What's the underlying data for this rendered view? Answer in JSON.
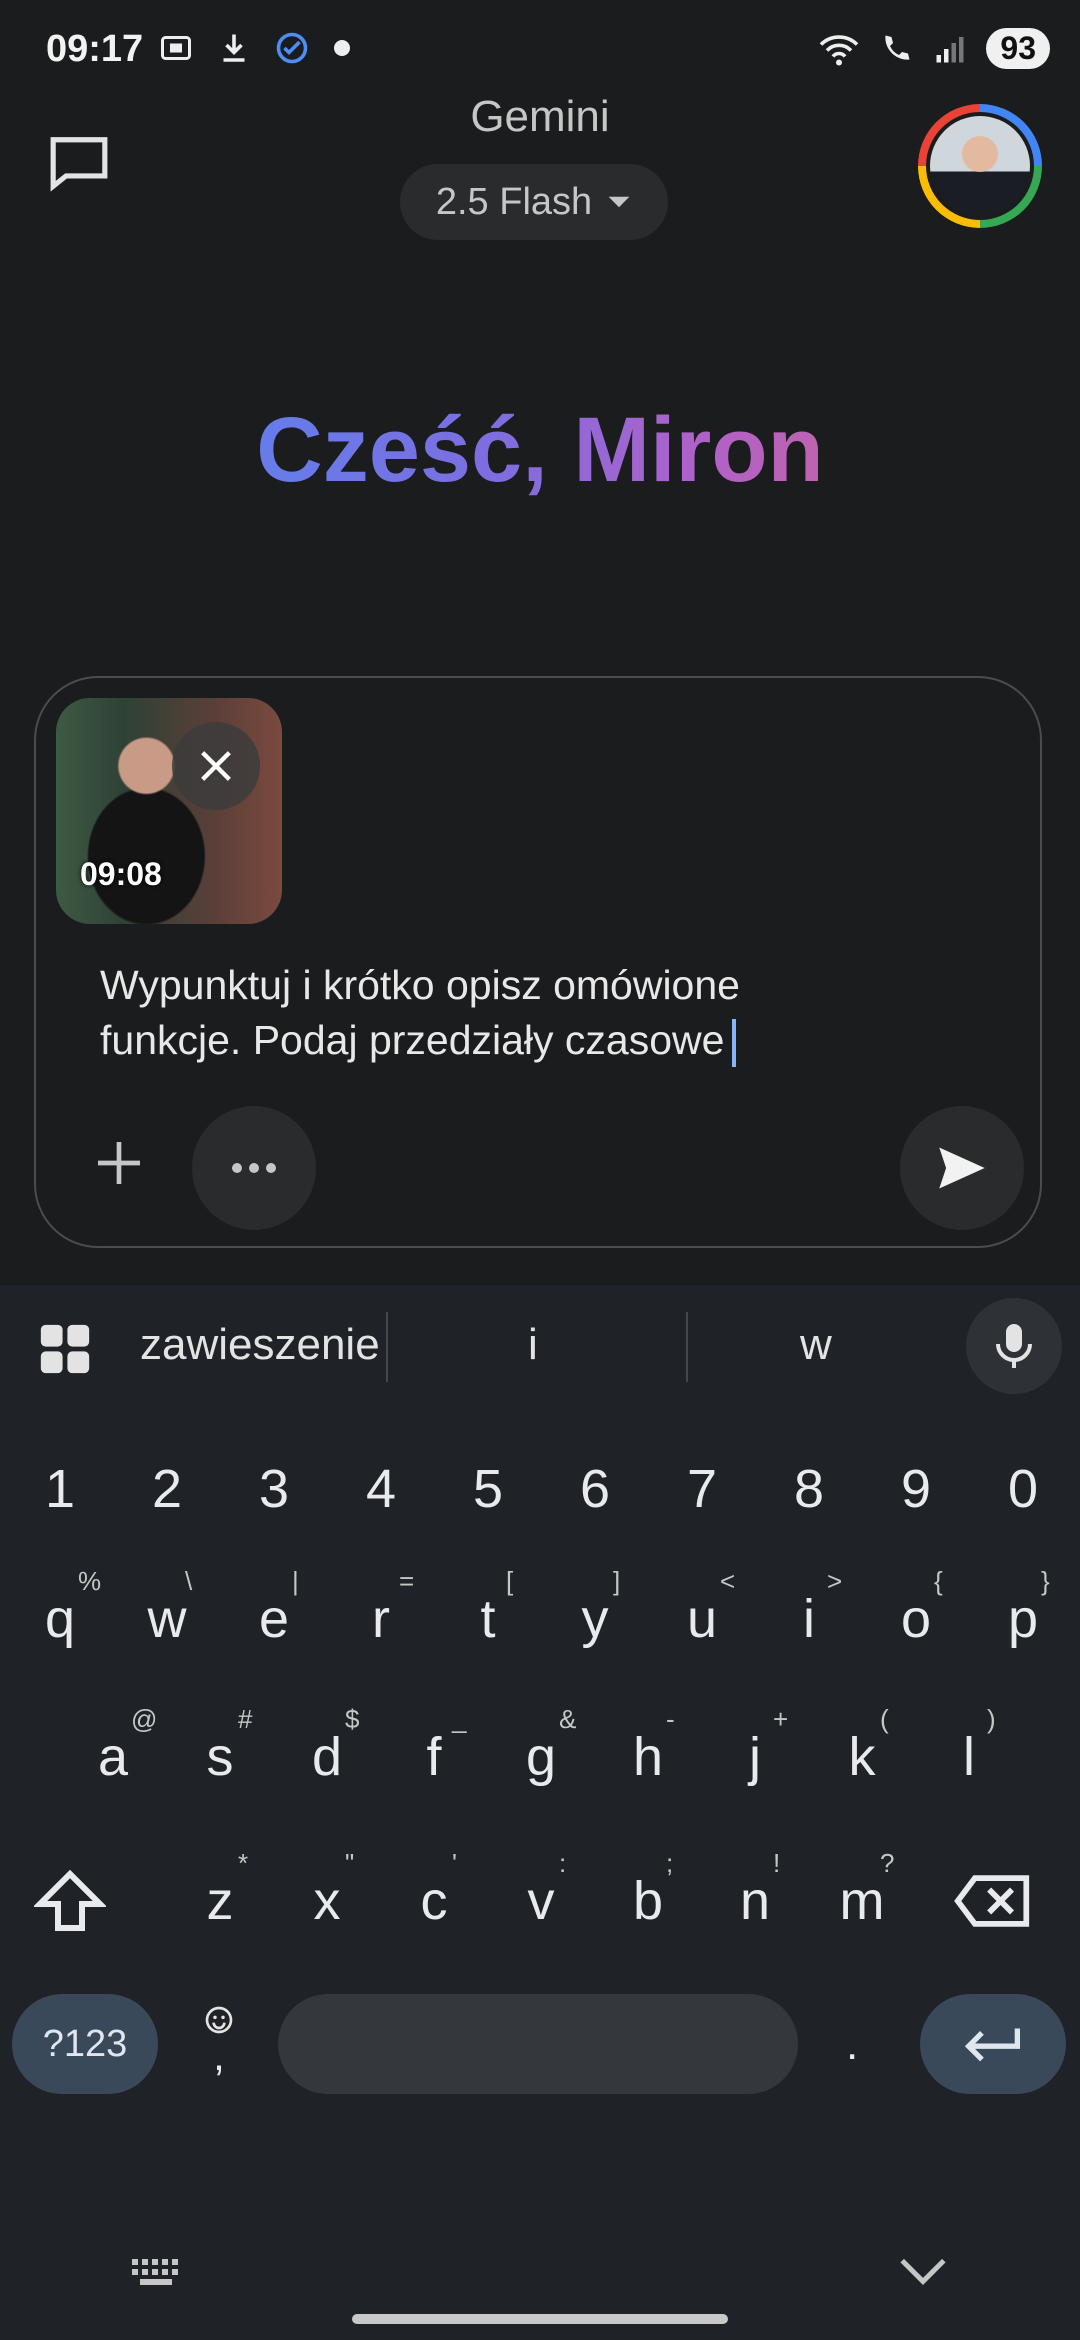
{
  "status_bar": {
    "time": "09:17",
    "battery": "93"
  },
  "header": {
    "app_title": "Gemini",
    "model": "2.5 Flash"
  },
  "greeting": "Cześć, Miron",
  "composer": {
    "attachment_time": "09:08",
    "prompt_line1": "Wypunktuj i krótko opisz omówione",
    "prompt_line2": "funkcje. Podaj przedziały czasowe"
  },
  "keyboard": {
    "suggestions": [
      "zawieszenie",
      "i",
      "w"
    ],
    "numbers": [
      "1",
      "2",
      "3",
      "4",
      "5",
      "6",
      "7",
      "8",
      "9",
      "0"
    ],
    "row1": [
      "q",
      "w",
      "e",
      "r",
      "t",
      "y",
      "u",
      "i",
      "o",
      "p"
    ],
    "row1_hints": [
      "%",
      "\\",
      "|",
      "=",
      "[",
      "]",
      "<",
      ">",
      "{",
      "}"
    ],
    "row2": [
      "a",
      "s",
      "d",
      "f",
      "g",
      "h",
      "j",
      "k",
      "l"
    ],
    "row2_hints": [
      "@",
      "#",
      "$",
      "_",
      "&",
      "-",
      "+",
      "(",
      ")"
    ],
    "row3": [
      "z",
      "x",
      "c",
      "v",
      "b",
      "n",
      "m"
    ],
    "row3_hints": [
      "*",
      "\"",
      "'",
      ":",
      ";",
      "!",
      "?"
    ],
    "symbols_label": "?123",
    "period": ".",
    "comma": ","
  }
}
